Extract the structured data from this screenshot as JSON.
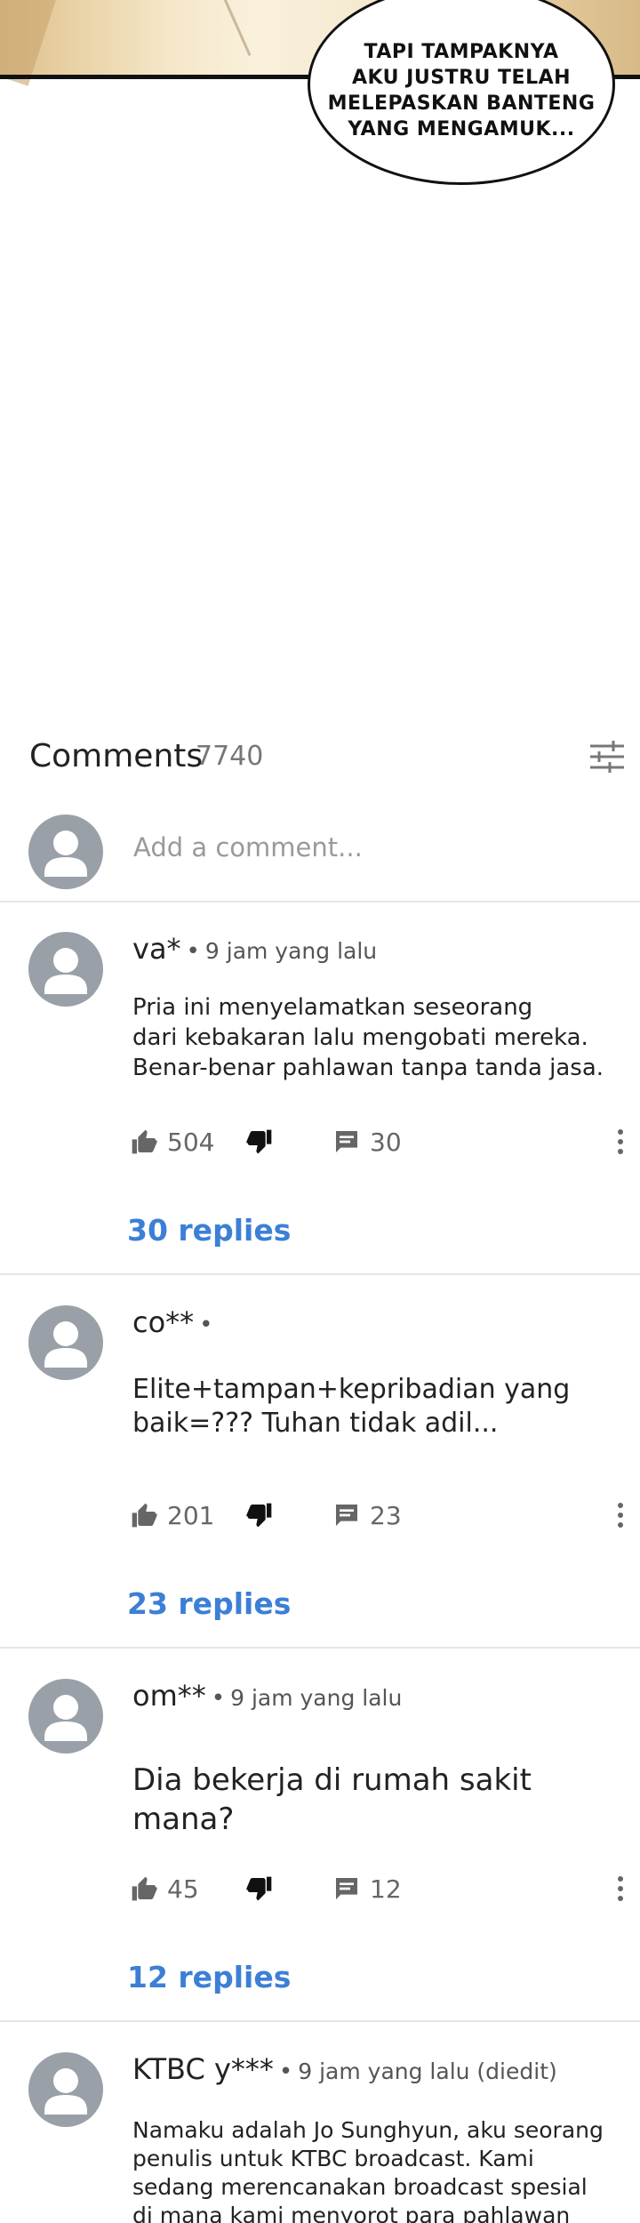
{
  "comic": {
    "bubble_text": "TAPI TAMPAKNYA\nAKU JUSTRU TELAH\nMELEPASKAN BANTENG\nYANG MENGAMUK..."
  },
  "comments": {
    "title": "Comments",
    "count": "7740",
    "add_placeholder": "Add a comment..."
  },
  "items": [
    {
      "user": "va*",
      "dot": "•",
      "time": "9 jam yang lalu",
      "text": "Pria ini menyelamatkan seseorang\ndari kebakaran lalu mengobati mereka.\nBenar-benar pahlawan tanpa tanda jasa.",
      "likes": "504",
      "replies_count": "30",
      "replies_label": "30 replies"
    },
    {
      "user": "co**",
      "dot": "•",
      "time": "",
      "text": "Elite+tampan+kepribadian yang\nbaik=??? Tuhan tidak adil...",
      "likes": "201",
      "replies_count": "23",
      "replies_label": "23 replies"
    },
    {
      "user": "om**",
      "dot": "•",
      "time": "9 jam yang lalu",
      "text": "Dia bekerja di rumah sakit mana?",
      "likes": "45",
      "replies_count": "12",
      "replies_label": "12 replies"
    },
    {
      "user": "KTBC y***",
      "dot": "•",
      "time": "9 jam yang lalu (diedit)",
      "text": "Namaku adalah Jo Sunghyun, aku seorang\npenulis untuk KTBC broadcast. Kami\nsedang merencanakan broadcast spesial\ndi mana kami menyorot para pahlawan"
    }
  ],
  "colors": {
    "accent_link": "#3c7fd6",
    "avatar": "#9aa0a8",
    "icon": "#666666"
  }
}
